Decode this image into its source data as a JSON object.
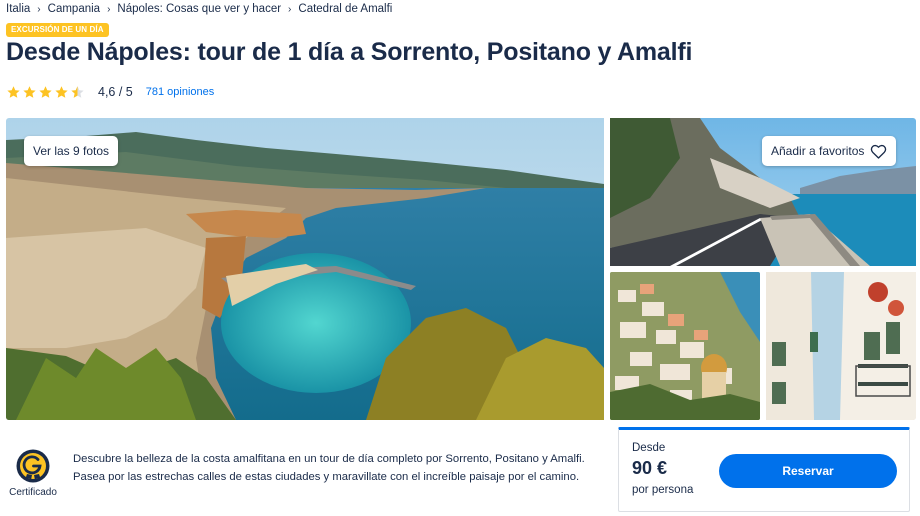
{
  "breadcrumb": [
    "Italia",
    "Campania",
    "Nápoles: Cosas que ver y hacer",
    "Catedral de Amalfi"
  ],
  "badge": "EXCURSIÓN DE UN DÍA",
  "title": "Desde Nápoles: tour de 1 día a Sorrento, Positano y Amalfi",
  "rating": {
    "value": "4,6 / 5",
    "stars": 4.6,
    "reviews": "781 opiniones",
    "star_color": "#fdc323"
  },
  "gallery": {
    "view_photos": "Ver las 9 fotos",
    "favorite": "Añadir a favoritos"
  },
  "certified": {
    "label": "Certificado",
    "icon": "certified-badge-icon"
  },
  "description": "Descubre la belleza de la costa amalfitana en un tour de día completo por Sorrento, Positano y Amalfi. Pasea por las estrechas calles de estas ciudades y maravillate con el increíble paisaje por el camino.",
  "pricing": {
    "from": "Desde",
    "price": "90 €",
    "per": "por persona",
    "cta": "Reservar"
  },
  "colors": {
    "primary": "#0071eb",
    "text": "#1a2b49",
    "accent": "#fdc323"
  }
}
